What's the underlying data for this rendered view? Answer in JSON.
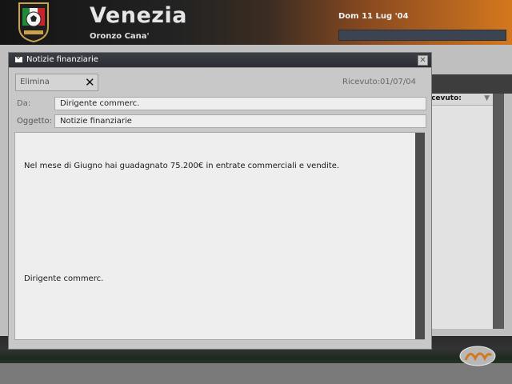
{
  "header": {
    "club_name": "Venezia",
    "manager_name": "Oronzo Cana'",
    "date": "Dom 11 Lug '04",
    "crest_icon": "italy-crest-icon",
    "colors": {
      "accent": "#d4781e",
      "dark": "#141414"
    }
  },
  "background": {
    "column_header": "icevuto:",
    "sort_icon": "triangle-down-icon",
    "logo_icon": "publisher-logo-icon"
  },
  "dialog": {
    "title": "Notizie finanziarie",
    "mail_icon": "envelope-icon",
    "close_icon": "close-icon",
    "delete_label": "Elimina",
    "delete_icon": "x-icon",
    "received": "Ricevuto:01/07/04",
    "from_label": "Da:",
    "from_value": "Dirigente commerc.",
    "subject_label": "Oggetto:",
    "subject_value": "Notizie finanziarie",
    "body": "Nel mese di Giugno hai guadagnato 75.200€ in entrate commerciali e vendite.",
    "signature": "Dirigente commerc."
  }
}
